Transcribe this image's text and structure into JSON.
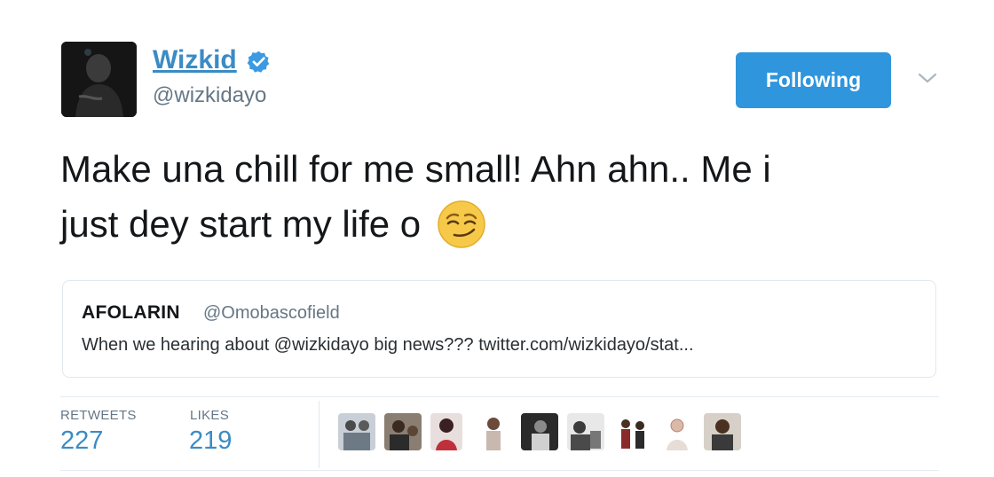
{
  "author": {
    "display_name": "Wizkid",
    "handle": "@wizkidayo",
    "verified": true
  },
  "follow_button": {
    "label": "Following"
  },
  "tweet": {
    "text_line1": "Make una chill for me small! Ahn ahn.. Me i",
    "text_line2": "just dey start my life o",
    "emoji": "smirking-face"
  },
  "quoted_tweet": {
    "name": "AFOLARIN",
    "handle": "@Omobascofield",
    "text": "When we hearing about @wizkidayo big news??? twitter.com/wizkidayo/stat..."
  },
  "stats": {
    "retweets_label": "RETWEETS",
    "retweets_count": "227",
    "likes_label": "LIKES",
    "likes_count": "219"
  },
  "likers": [
    "liker-1",
    "liker-2",
    "liker-3",
    "liker-4",
    "liker-5",
    "liker-6",
    "liker-7",
    "liker-8",
    "liker-9"
  ],
  "colors": {
    "link_blue": "#3b8bc4",
    "button_blue": "#2f95dc",
    "muted_gray": "#657786",
    "border_gray": "#e1e8ed",
    "emoji_yellow": "#f7c948"
  }
}
